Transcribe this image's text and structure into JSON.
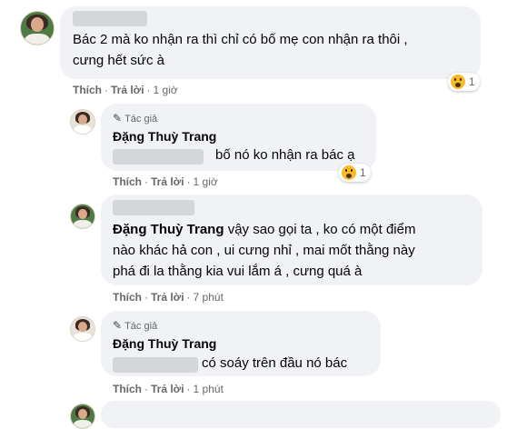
{
  "comments": [
    {
      "text_lines": [
        "Bác 2 mà ko nhận ra thì chỉ có bố mẹ con nhận ra thôi ,",
        "cưng hết sức à"
      ],
      "actions": {
        "like": "Thích",
        "reply": "Trả lời",
        "time": "1 giờ"
      },
      "reaction_count": "1"
    },
    {
      "author_badge": "Tác giả",
      "name": "Đặng Thuỳ Trang",
      "text": "bố nó ko nhận ra bác ạ",
      "actions": {
        "like": "Thích",
        "reply": "Trả lời",
        "time": "1 giờ"
      },
      "reaction_count": "1"
    },
    {
      "name": "Đặng Thuỳ Trang",
      "text_first": "vậy sao gọi ta , ko có một điểm",
      "text_lines": [
        "nào khác hả con , ui cưng nhỉ , mai mốt thằng này",
        "phá đi la thằng kia vui lắm á , cưng quá à"
      ],
      "actions": {
        "like": "Thích",
        "reply": "Trả lời",
        "time": "7 phút"
      }
    },
    {
      "author_badge": "Tác giả",
      "name": "Đặng Thuỳ Trang",
      "text": "có soáy trên đầu nó bác",
      "actions": {
        "like": "Thích",
        "reply": "Trả lời",
        "time": "1 phút"
      }
    }
  ],
  "separator": "·"
}
